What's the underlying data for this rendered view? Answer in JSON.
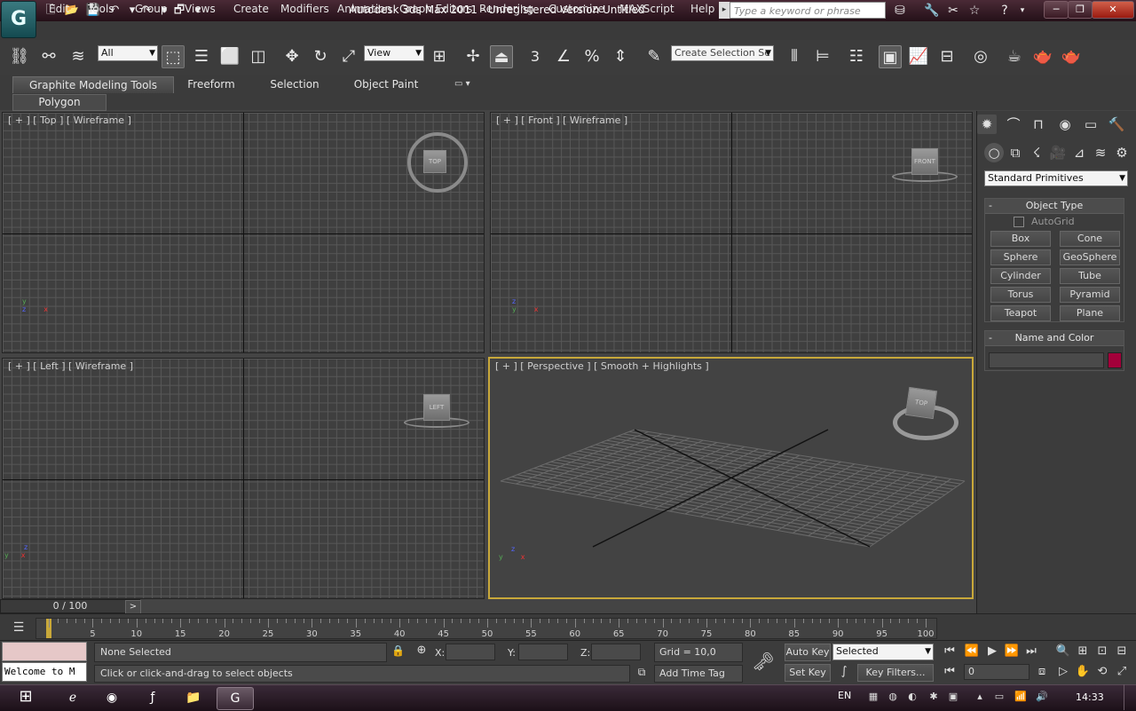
{
  "window": {
    "title": "Autodesk 3ds Max  2011  -  Unregistered Version    Untitled",
    "search_placeholder": "Type a keyword or phrase",
    "logo_glyph": "G"
  },
  "menu": [
    "Edit",
    "Tools",
    "Group",
    "Views",
    "Create",
    "Modifiers",
    "Animation",
    "Graph Editors",
    "Rendering",
    "Customize",
    "MAXScript",
    "Help"
  ],
  "toolbar": {
    "filter_value": "All",
    "refcoord_value": "View",
    "selection_set_placeholder": "Create Selection Se",
    "snap_label": "3"
  },
  "ribbon": {
    "tabs": [
      "Graphite Modeling Tools",
      "Freeform",
      "Selection",
      "Object Paint"
    ],
    "panel_label": "Polygon Modeling"
  },
  "viewports": {
    "top": {
      "label": "[ + ] [ Top ] [ Wireframe ]",
      "cube_text": "TOP"
    },
    "front": {
      "label": "[ + ] [ Front ] [ Wireframe ]",
      "cube_text": "FRONT"
    },
    "left": {
      "label": "[ + ] [ Left ] [ Wireframe ]",
      "cube_text": "LEFT"
    },
    "perspective": {
      "label": "[ + ] [ Perspective ] [ Smooth + Highlights ]",
      "cube_text": "TOP"
    }
  },
  "command_panel": {
    "category_value": "Standard Primitives",
    "object_type_title": "Object Type",
    "autogrid_label": "AutoGrid",
    "primitives": [
      "Box",
      "Cone",
      "Sphere",
      "GeoSphere",
      "Cylinder",
      "Tube",
      "Torus",
      "Pyramid",
      "Teapot",
      "Plane"
    ],
    "name_color_title": "Name and Color",
    "object_color": "#a3003a"
  },
  "timeline": {
    "frame_display": "0 / 100",
    "next_label": ">",
    "ticks": [
      "5",
      "10",
      "15",
      "20",
      "25",
      "30",
      "35",
      "40",
      "45",
      "50",
      "55",
      "60",
      "65",
      "70",
      "75",
      "80",
      "85",
      "90",
      "95",
      "100"
    ]
  },
  "status": {
    "maxscript_text": "Welcome to M",
    "selection_status": "None Selected",
    "prompt": "Click or click-and-drag to select objects",
    "x_label": "X:",
    "y_label": "Y:",
    "z_label": "Z:",
    "grid_text": "Grid = 10,0",
    "add_time_tag": "Add Time Tag",
    "auto_key": "Auto Key",
    "set_key": "Set Key",
    "key_mode_value": "Selected",
    "key_filters": "Key Filters...",
    "current_frame": "0"
  },
  "taskbar": {
    "language": "EN",
    "clock": "14:33"
  }
}
